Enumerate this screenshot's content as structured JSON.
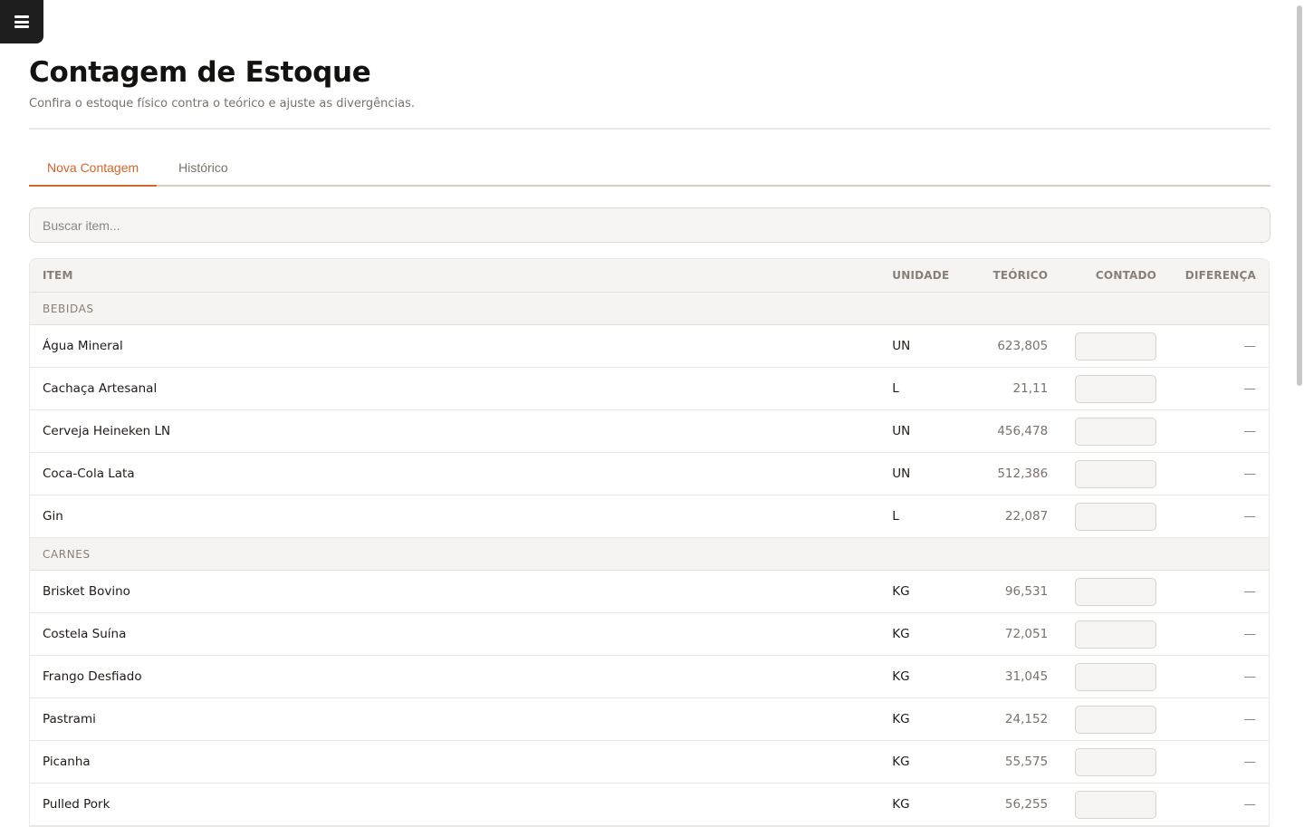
{
  "menu": {
    "icon": "hamburger-menu-icon"
  },
  "header": {
    "title": "Contagem de Estoque",
    "subtitle": "Confira o estoque físico contra o teórico e ajuste as divergências."
  },
  "tabs": [
    {
      "label": "Nova Contagem",
      "active": true
    },
    {
      "label": "Histórico",
      "active": false
    }
  ],
  "search": {
    "placeholder": "Buscar item...",
    "value": ""
  },
  "table": {
    "columns": [
      "ITEM",
      "UNIDADE",
      "TEÓRICO",
      "CONTADO",
      "DIFERENÇA"
    ],
    "groups": [
      {
        "name": "BEBIDAS",
        "rows": [
          {
            "item": "Água Mineral",
            "unit": "UN",
            "theoretical": "623,805",
            "counted": "",
            "difference": "—"
          },
          {
            "item": "Cachaça Artesanal",
            "unit": "L",
            "theoretical": "21,11",
            "counted": "",
            "difference": "—"
          },
          {
            "item": "Cerveja Heineken LN",
            "unit": "UN",
            "theoretical": "456,478",
            "counted": "",
            "difference": "—"
          },
          {
            "item": "Coca-Cola Lata",
            "unit": "UN",
            "theoretical": "512,386",
            "counted": "",
            "difference": "—"
          },
          {
            "item": "Gin",
            "unit": "L",
            "theoretical": "22,087",
            "counted": "",
            "difference": "—"
          }
        ]
      },
      {
        "name": "CARNES",
        "rows": [
          {
            "item": "Brisket Bovino",
            "unit": "KG",
            "theoretical": "96,531",
            "counted": "",
            "difference": "—"
          },
          {
            "item": "Costela Suína",
            "unit": "KG",
            "theoretical": "72,051",
            "counted": "",
            "difference": "—"
          },
          {
            "item": "Frango Desfiado",
            "unit": "KG",
            "theoretical": "31,045",
            "counted": "",
            "difference": "—"
          },
          {
            "item": "Pastrami",
            "unit": "KG",
            "theoretical": "24,152",
            "counted": "",
            "difference": "—"
          },
          {
            "item": "Picanha",
            "unit": "KG",
            "theoretical": "55,575",
            "counted": "",
            "difference": "—"
          },
          {
            "item": "Pulled Pork",
            "unit": "KG",
            "theoretical": "56,255",
            "counted": "",
            "difference": "—"
          }
        ]
      }
    ]
  },
  "colors": {
    "accent": "#d4642a",
    "menu_bg": "#1e1e1e",
    "muted_text": "#7b716a",
    "header_bg": "#f5f4f2"
  }
}
